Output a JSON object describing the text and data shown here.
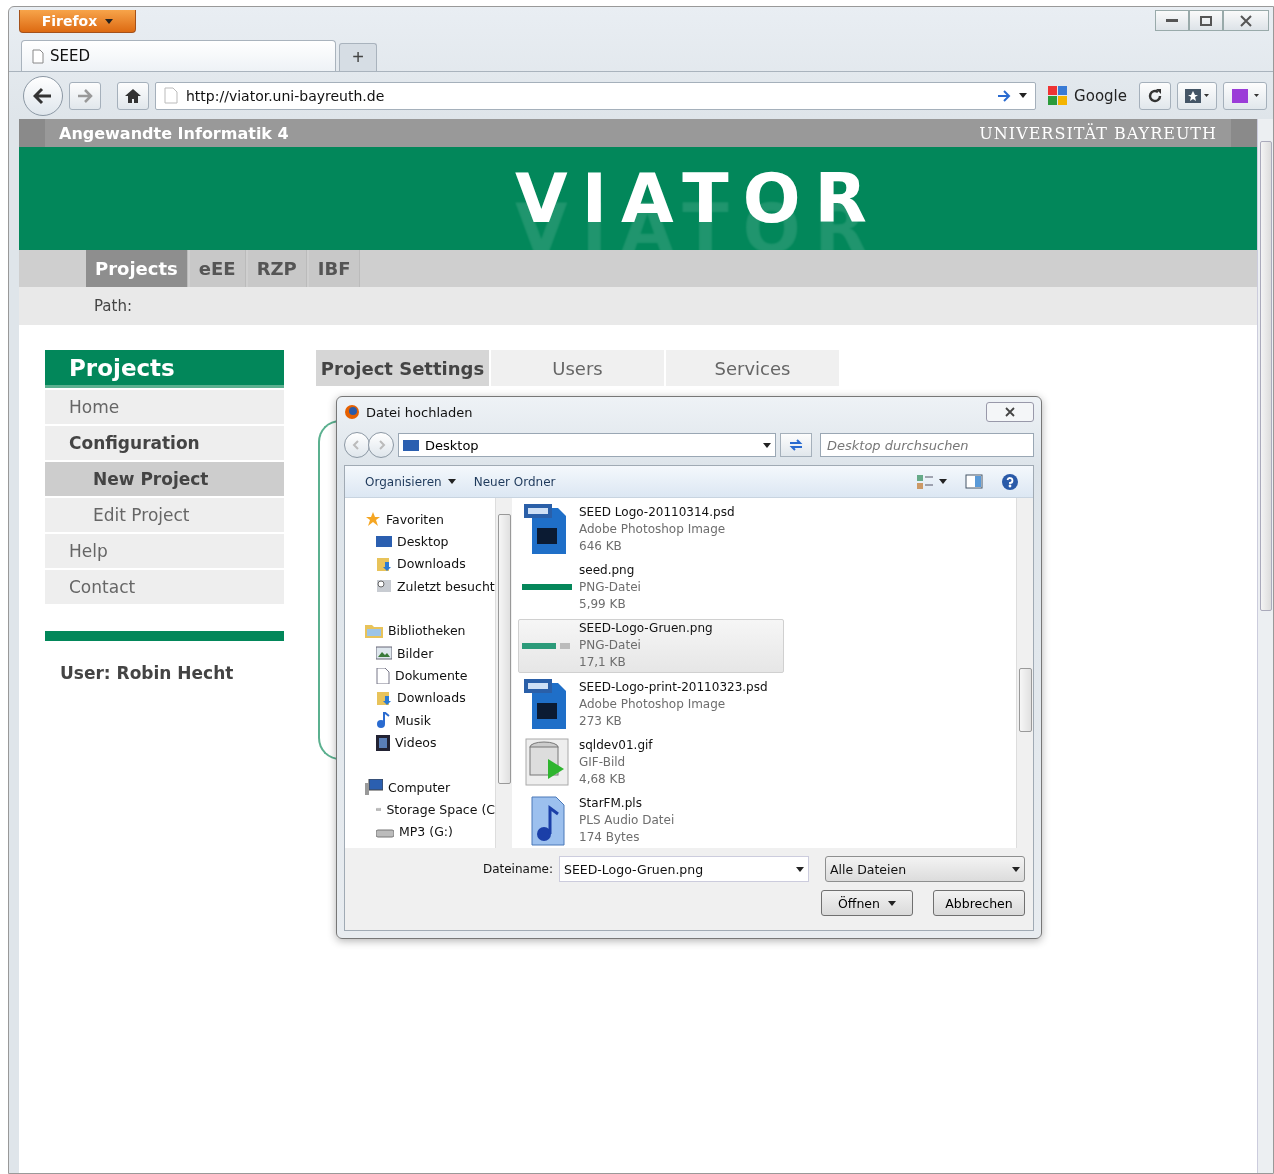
{
  "browser": {
    "menu_button": "Firefox",
    "tabs": [
      {
        "title": "SEED",
        "selected": true
      }
    ],
    "new_tab": "+",
    "url": "http://viator.uni-bayreuth.de",
    "search_engine": "Google"
  },
  "site": {
    "header_left": "Angewandte Informatik 4",
    "header_right": "UNIVERSITÄT BAYREUTH",
    "logo": "VIATOR",
    "nav": [
      {
        "label": "Projects",
        "selected": true
      },
      {
        "label": "eEE",
        "selected": false
      },
      {
        "label": "RZP",
        "selected": false
      },
      {
        "label": "IBF",
        "selected": false
      }
    ],
    "path_label": "Path:"
  },
  "sidebar": {
    "title": "Projects",
    "items": [
      {
        "label": "Home",
        "kind": "link",
        "selected": false
      },
      {
        "label": "Configuration",
        "kind": "heading",
        "selected": false,
        "children": [
          {
            "label": "New Project",
            "selected": true
          },
          {
            "label": "Edit Project",
            "selected": false
          }
        ]
      },
      {
        "label": "Help",
        "kind": "link",
        "selected": false
      },
      {
        "label": "Contact",
        "kind": "link",
        "selected": false
      }
    ],
    "user": "User: Robin Hecht"
  },
  "content_tabs": [
    {
      "label": "Project Settings",
      "selected": true
    },
    {
      "label": "Users",
      "selected": false
    },
    {
      "label": "Services",
      "selected": false
    }
  ],
  "dialog": {
    "title": "Datei hochladen",
    "location": "Desktop",
    "search_placeholder": "Desktop durchsuchen",
    "toolbar": [
      {
        "label": "Organisieren",
        "kind": "menu"
      },
      {
        "label": "Neuer Ordner",
        "kind": "plain"
      }
    ],
    "tree": [
      {
        "label": "Favoriten",
        "kind": "star",
        "children": [
          {
            "label": "Desktop",
            "kind": "desktop"
          },
          {
            "label": "Downloads",
            "kind": "download"
          },
          {
            "label": "Zuletzt besucht",
            "kind": "recent"
          }
        ]
      },
      {
        "label": "Bibliotheken",
        "kind": "folder",
        "children": [
          {
            "label": "Bilder",
            "kind": "image"
          },
          {
            "label": "Dokumente",
            "kind": "document"
          },
          {
            "label": "Downloads",
            "kind": "download"
          },
          {
            "label": "Musik",
            "kind": "music"
          },
          {
            "label": "Videos",
            "kind": "video"
          }
        ]
      },
      {
        "label": "Computer",
        "kind": "computer",
        "children": [
          {
            "label": "Storage Space (C",
            "kind": "drive"
          },
          {
            "label": "MP3 (G:)",
            "kind": "drive"
          }
        ]
      }
    ],
    "files": [
      {
        "name": "SEED Logo-20110314.psd",
        "type": "Adobe Photoshop Image",
        "size": "646 KB",
        "kind": "psd",
        "selected": false
      },
      {
        "name": "seed.png",
        "type": "PNG-Datei",
        "size": "5,99 KB",
        "kind": "banner",
        "selected": false
      },
      {
        "name": "SEED-Logo-Gruen.png",
        "type": "PNG-Datei",
        "size": "17,1 KB",
        "kind": "logo",
        "selected": true
      },
      {
        "name": "SEED-Logo-print-20110323.psd",
        "type": "Adobe Photoshop Image",
        "size": "273 KB",
        "kind": "psd",
        "selected": false
      },
      {
        "name": "sqldev01.gif",
        "type": "GIF-Bild",
        "size": "4,68 KB",
        "kind": "database",
        "selected": false
      },
      {
        "name": "StarFM.pls",
        "type": "PLS Audio Datei",
        "size": "174 Bytes",
        "kind": "audio",
        "selected": false
      }
    ],
    "filename_label": "Dateiname:",
    "filename": "SEED-Logo-Gruen.png",
    "filter": "Alle Dateien",
    "buttons": [
      {
        "label": "Öffnen",
        "kind": "split"
      },
      {
        "label": "Abbrechen",
        "kind": "plain"
      }
    ]
  }
}
